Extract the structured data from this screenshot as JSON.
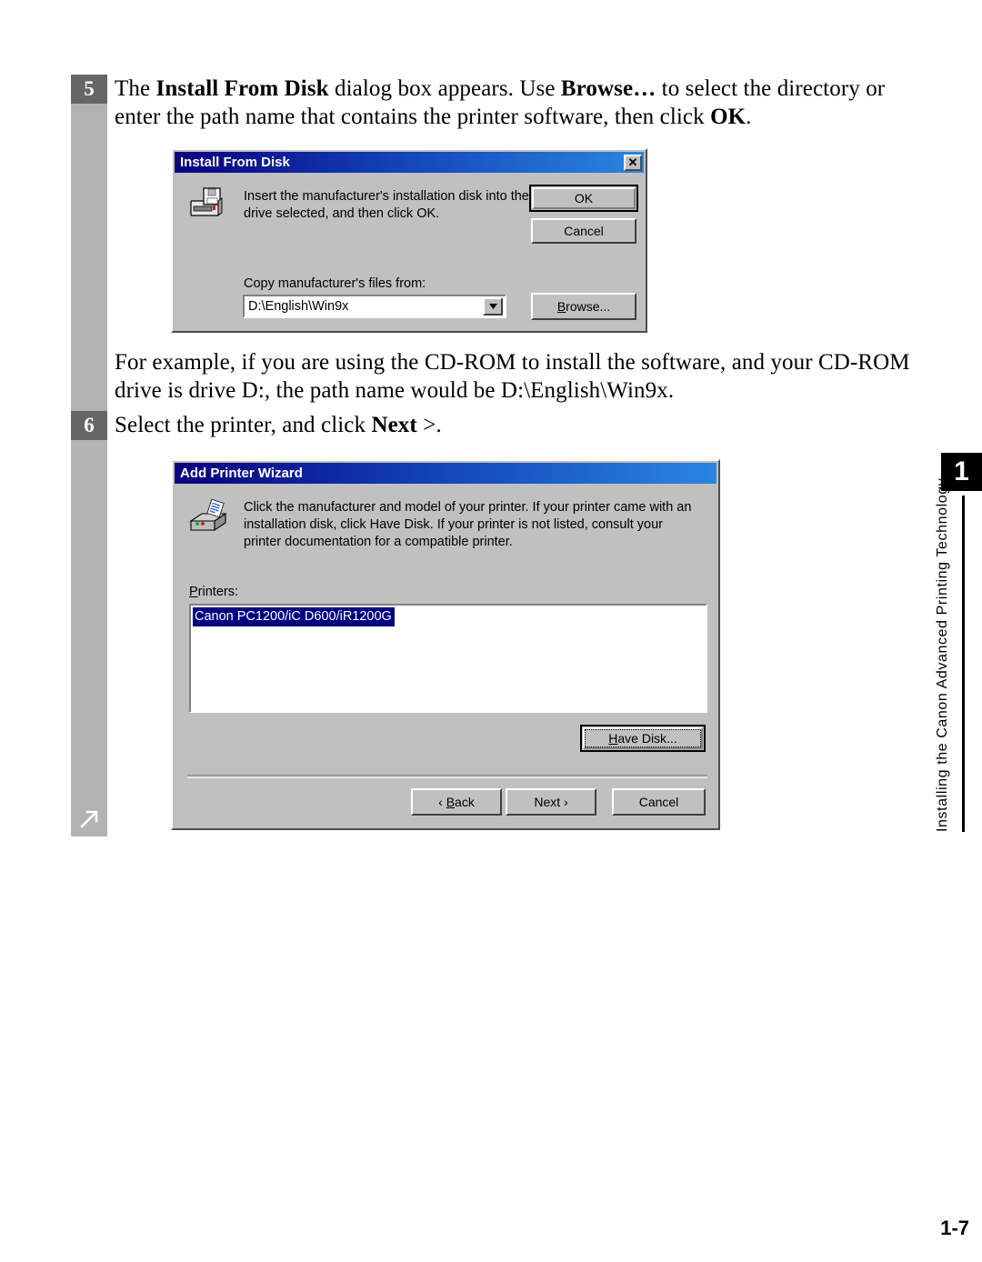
{
  "page": {
    "number": "1-7",
    "chapter_tab": "1",
    "chapter_title": "Installing the Canon Advanced Printing Technology"
  },
  "steps": [
    {
      "number": "5",
      "text_runs": [
        {
          "t": "The ",
          "b": false
        },
        {
          "t": "Install From Disk",
          "b": true
        },
        {
          "t": " dialog box appears. Use ",
          "b": false
        },
        {
          "t": "Browse…",
          "b": true
        },
        {
          "t": " to select the directory or enter the path name that contains the printer software, then click ",
          "b": false
        },
        {
          "t": "OK",
          "b": true
        },
        {
          "t": ".",
          "b": false
        }
      ]
    },
    {
      "number": "6",
      "text_runs": [
        {
          "t": "Select the printer, and click ",
          "b": false
        },
        {
          "t": "Next",
          "b": true
        },
        {
          "t": " >.",
          "b": false
        }
      ]
    }
  ],
  "example_paragraph": {
    "text_runs": [
      {
        "t": "For example, if you are using the CD-ROM to install the software, and your CD-ROM drive is drive D:, the path name would be D:\\English\\Win9x.",
        "b": false
      }
    ]
  },
  "rail": {
    "arrow_icon": "arrow-up-right-icon"
  },
  "install_from_disk_dialog": {
    "title": "Install From Disk",
    "close_label": "✕",
    "icon": "floppy-disk-drive-icon",
    "message": "Insert the manufacturer's installation disk into the drive selected, and then click OK.",
    "ok_label": "OK",
    "cancel_label": "Cancel",
    "copy_from_label": "Copy manufacturer's files from:",
    "path_value": "D:\\English\\Win9x",
    "path_placeholder": "D:\\English\\Win9x",
    "combo_arrow_icon": "chevron-down-icon",
    "browse_label_pre": "B",
    "browse_label_post": "rowse..."
  },
  "add_printer_wizard_dialog": {
    "title": "Add Printer Wizard",
    "icon": "printer-icon",
    "message": "Click the manufacturer and model of your printer. If your printer came with an installation disk, click Have Disk. If your printer is not listed, consult your printer documentation for a compatible printer.",
    "printers_label_pre": "P",
    "printers_label_post": "rinters:",
    "printers": [
      "Canon PC1200/iC D600/iR1200G"
    ],
    "selected_printer": "Canon PC1200/iC D600/iR1200G",
    "have_disk_label_pre": "H",
    "have_disk_label_post": "ave Disk...",
    "back_label_pre": "‹ ",
    "back_label_key": "B",
    "back_label_post": "ack",
    "next_label": "Next ›",
    "cancel_label": "Cancel"
  },
  "colors": {
    "dialog_face": "#c0c0c0",
    "title_bar_start": "#0a007d",
    "title_bar_end": "#2a86e0",
    "selection_blue": "#000080",
    "rail_gray": "#b3b3b3",
    "step_box_gray": "#666666"
  }
}
